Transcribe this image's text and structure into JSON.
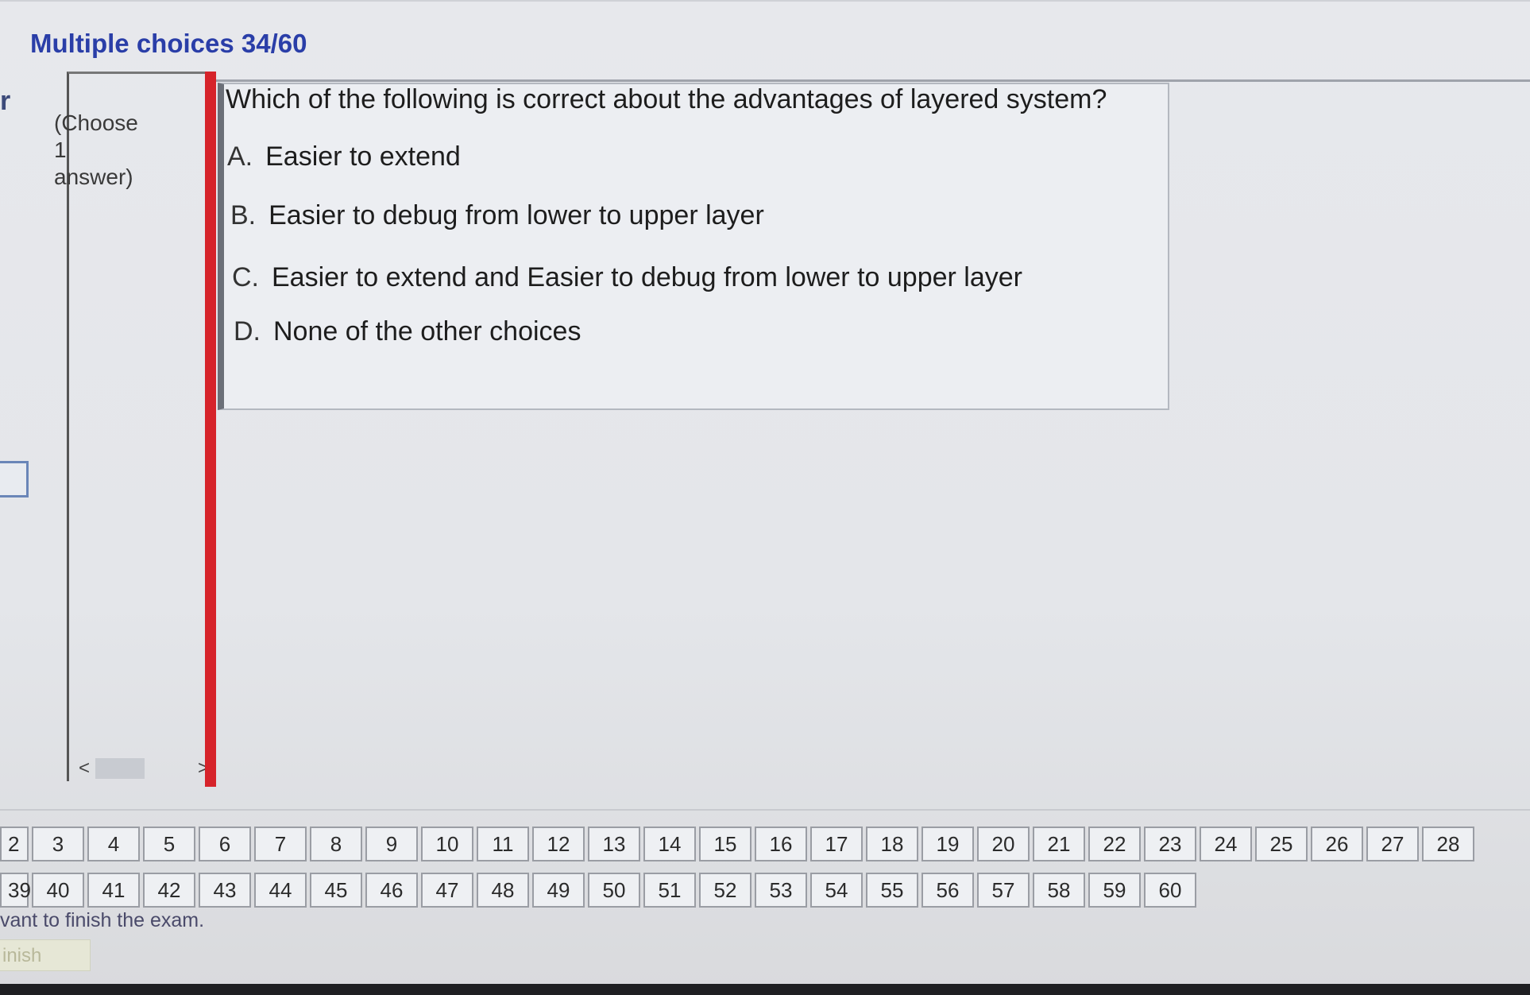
{
  "header": {
    "title": "Multiple choices 34/60"
  },
  "edge_glyph": "r",
  "sidebar": {
    "choose_note": [
      "(Choose",
      "1",
      "answer)"
    ]
  },
  "scrollbar": {
    "left_arrow": "<",
    "right_arrow": ">"
  },
  "question": {
    "text": "Which of the following is correct about the advantages of layered system?",
    "options": [
      {
        "letter": "A.",
        "text": "Easier to extend"
      },
      {
        "letter": "B.",
        "text": "Easier to debug from lower to upper layer"
      },
      {
        "letter": "C.",
        "text": "Easier to extend and Easier to debug from lower to upper layer"
      },
      {
        "letter": "D.",
        "text": "None of the other choices"
      }
    ]
  },
  "navigator": {
    "row1": [
      "2",
      "3",
      "4",
      "5",
      "6",
      "7",
      "8",
      "9",
      "10",
      "11",
      "12",
      "13",
      "14",
      "15",
      "16",
      "17",
      "18",
      "19",
      "20",
      "21",
      "22",
      "23",
      "24",
      "25",
      "26",
      "27",
      "28"
    ],
    "row2": [
      "39",
      "40",
      "41",
      "42",
      "43",
      "44",
      "45",
      "46",
      "47",
      "48",
      "49",
      "50",
      "51",
      "52",
      "53",
      "54",
      "55",
      "56",
      "57",
      "58",
      "59",
      "60"
    ]
  },
  "footer": {
    "finish_hint": "vant to finish the exam.",
    "finish_label": "inish"
  }
}
